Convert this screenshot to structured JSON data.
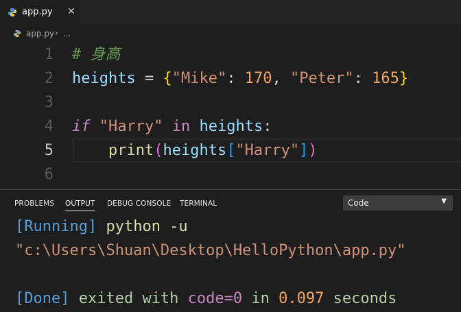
{
  "tab": {
    "filename": "app.py",
    "close_glyph": "✕"
  },
  "breadcrumb": {
    "file": "app.py",
    "separator": "›",
    "more": "..."
  },
  "editor": {
    "line_numbers": [
      "1",
      "2",
      "3",
      "4",
      "5",
      "6"
    ],
    "line1": {
      "comment": "# 身高"
    },
    "line2": {
      "var": "heights",
      "eq": " = ",
      "open_brace": "{",
      "key1": "\"Mike\"",
      "colon1": ": ",
      "val1": "170",
      "comma": ", ",
      "key2": "\"Peter\"",
      "colon2": ": ",
      "val2": "165",
      "close_brace": "}"
    },
    "line4": {
      "kw_if": "if",
      "sp1": " ",
      "str": "\"Harry\"",
      "sp2": " ",
      "kw_in": "in",
      "sp3": " ",
      "var": "heights",
      "colon": ":"
    },
    "line5": {
      "indent": "    ",
      "fn": "print",
      "open_paren": "(",
      "var": "heights",
      "open_brack": "[",
      "str": "\"Harry\"",
      "close_brack": "]",
      "close_paren": ")"
    }
  },
  "panel": {
    "tabs": [
      "PROBLEMS",
      "OUTPUT",
      "DEBUG CONSOLE",
      "TERMINAL"
    ],
    "active_tab": "OUTPUT",
    "channel_select": "Code",
    "dropdown_glyph": "▼",
    "output": {
      "line1_tag": "[Running]",
      "line1_cmd": " python -u",
      "line2_path": "\"c:\\Users\\Shuan\\Desktop\\HelloPython\\app.py\"",
      "line4_tag": "[Done]",
      "line4_text1": " exited with ",
      "line4_code": "code=0",
      "line4_text2": " in ",
      "line4_time": "0.097",
      "line4_text3": " seconds"
    }
  },
  "colors": {
    "editor_bg": "#1e1e1e",
    "tabbar_bg": "#252526",
    "comment": "#6a9955",
    "string": "#ce9178",
    "number": "#f5a55f",
    "keyword": "#c586c0"
  }
}
